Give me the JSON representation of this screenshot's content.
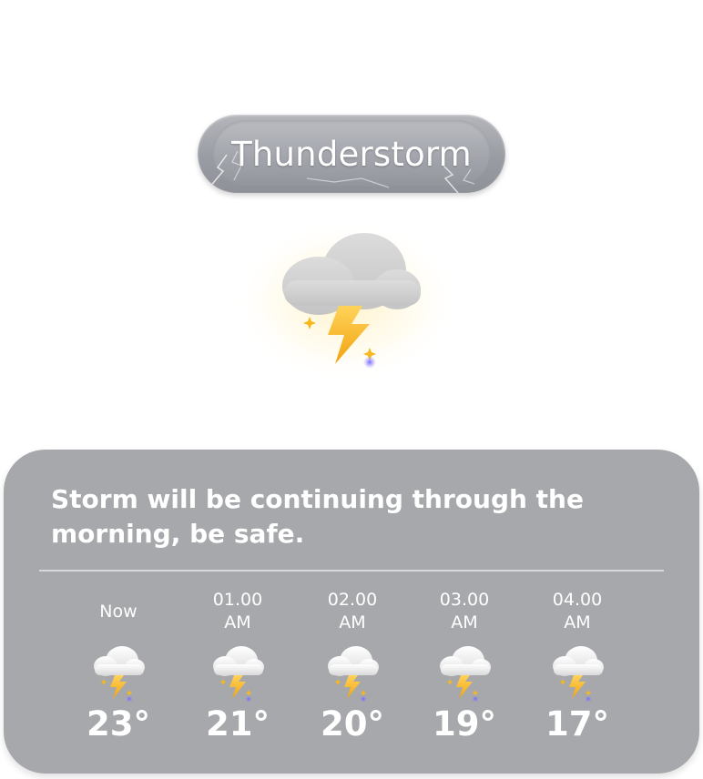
{
  "condition": {
    "label": "Thunderstorm",
    "icon": "thunderstorm-cloud-icon"
  },
  "forecast": {
    "summary": "Storm will be continuing through the morning, be safe.",
    "hours": [
      {
        "time": "Now",
        "period": "",
        "temp": "23°",
        "icon": "thunderstorm-cloud-icon"
      },
      {
        "time": "01.00",
        "period": "AM",
        "temp": "21°",
        "icon": "thunderstorm-cloud-icon"
      },
      {
        "time": "02.00",
        "period": "AM",
        "temp": "20°",
        "icon": "thunderstorm-cloud-icon"
      },
      {
        "time": "03.00",
        "period": "AM",
        "temp": "19°",
        "icon": "thunderstorm-cloud-icon"
      },
      {
        "time": "04.00",
        "period": "AM",
        "temp": "17°",
        "icon": "thunderstorm-cloud-icon"
      }
    ]
  },
  "colors": {
    "card_background": "#a6a8ab",
    "bolt": "#f6b81c",
    "text": "#ffffff"
  }
}
